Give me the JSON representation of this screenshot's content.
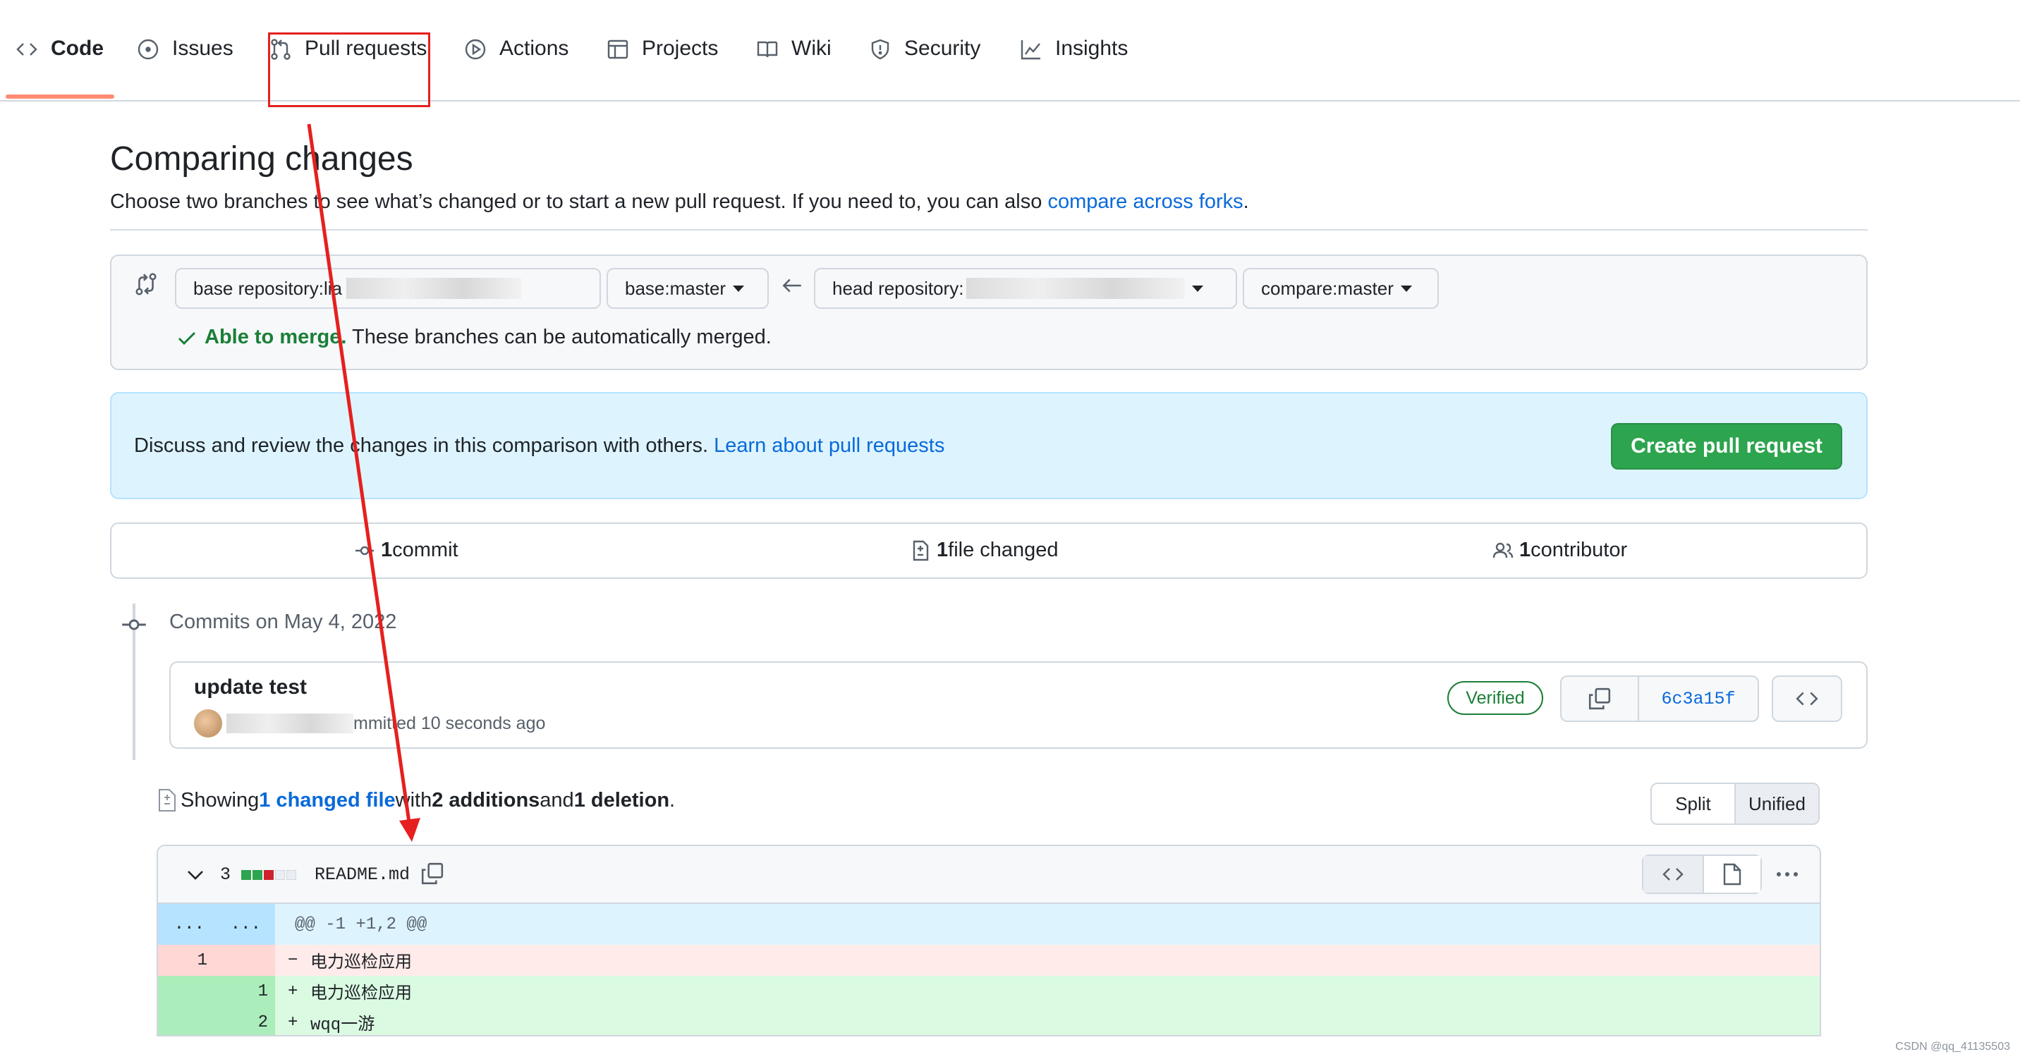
{
  "nav": {
    "tabs": [
      {
        "label": "Code",
        "icon": "code-icon"
      },
      {
        "label": "Issues",
        "icon": "issue-opened-icon"
      },
      {
        "label": "Pull requests",
        "icon": "git-pull-request-icon"
      },
      {
        "label": "Actions",
        "icon": "play-icon"
      },
      {
        "label": "Projects",
        "icon": "table-icon"
      },
      {
        "label": "Wiki",
        "icon": "book-icon"
      },
      {
        "label": "Security",
        "icon": "shield-icon"
      },
      {
        "label": "Insights",
        "icon": "graph-icon"
      }
    ],
    "active_color": "#fd8c73"
  },
  "page": {
    "title": "Comparing changes",
    "subtitle": "Choose two branches to see what’s changed or to start a new pull request. If you need to, you can also ",
    "subtitle_link": "compare across forks",
    "subtitle_end": "."
  },
  "range": {
    "base_repo_label": "base repository: ",
    "base_repo_value": "lia",
    "base_branch_label": "base: ",
    "base_branch_value": "master",
    "head_repo_label": "head repository: ",
    "compare_label": "compare: ",
    "compare_value": "master",
    "merge_status": "Able to merge.",
    "merge_text": "These branches can be automatically merged."
  },
  "flash": {
    "text": "Discuss and review the changes in this comparison with others. ",
    "link": "Learn about pull requests",
    "button": "Create pull request",
    "button_color": "#2da44e"
  },
  "stats": {
    "commits_count": "1",
    "commits_label": " commit",
    "files_count": "1",
    "files_label": " file changed",
    "contributors_count": "1",
    "contributors_label": " contributor"
  },
  "commits": {
    "date_header": "Commits on May 4, 2022",
    "items": [
      {
        "title": "update test",
        "meta": "mmitted 10 seconds ago",
        "badge": "Verified",
        "sha": "6c3a15f"
      }
    ]
  },
  "diff_summary": {
    "prefix": "Showing ",
    "changed": "1 changed file",
    "with": " with ",
    "additions": "2 additions",
    "and": " and ",
    "deletions": "1 deletion",
    "end": ".",
    "split": "Split",
    "unified": "Unified"
  },
  "file": {
    "changes": "3",
    "name": "README.md",
    "hunk_left": "...",
    "hunk_right": "...",
    "hunk": "@@ -1 +1,2 @@",
    "lines": [
      {
        "type": "del",
        "old": "1",
        "new": "",
        "sign": "−",
        "text": "电力巡检应用"
      },
      {
        "type": "add",
        "old": "",
        "new": "1",
        "sign": "+",
        "text": "电力巡检应用"
      },
      {
        "type": "add",
        "old": "",
        "new": "2",
        "sign": "+",
        "text": "wqq一游"
      }
    ]
  },
  "watermark": "CSDN @qq_41135503"
}
